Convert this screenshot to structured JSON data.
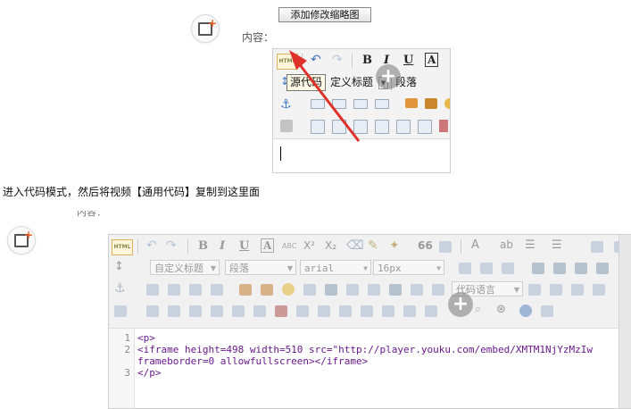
{
  "top_form": {
    "add_thumbnail_button": "添加修改缩略图",
    "content_label": "内容："
  },
  "editor_small": {
    "html_button_label": "HTML",
    "tooltip": "源代码",
    "custom_heading_select": "定义标题",
    "paragraph_select": "段落",
    "bold": "B",
    "italic": "I",
    "underline": "U",
    "fontcolor": "A"
  },
  "instruction_text": "进入代码模式，然后将视频【通用代码】复制到这里面",
  "cut_label": "内容：",
  "editor_large": {
    "html_button_label": "HTML",
    "bold": "B",
    "italic": "I",
    "underline": "U",
    "fontcolor": "A",
    "strikethrough": "ABC",
    "superscript": "X²",
    "subscript": "X₂",
    "quote": "66",
    "font_size_A": "A",
    "heading_select": "自定义标题",
    "paragraph_select": "段落",
    "font_select": "arial",
    "size_select": "16px",
    "code_language_select": "代码语言"
  },
  "code_lines": [
    {
      "n": "1",
      "text": "<p>"
    },
    {
      "n": "2",
      "text": "<iframe height=498 width=510 src=\"http://player.youku.com/embed/XMTM1NjYzMzIw"
    },
    {
      "n": "",
      "text": "frameborder=0 allowfullscreen></iframe>"
    },
    {
      "n": "3",
      "text": "</p>"
    }
  ],
  "colors": {
    "arrow": "#e0302a",
    "html_button_bg": "#fff6dc",
    "code_text": "#6a1a8c"
  }
}
